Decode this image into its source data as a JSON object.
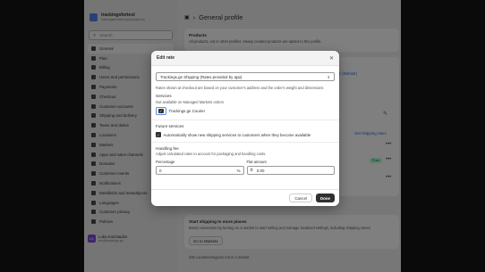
{
  "store": {
    "name": "trackingsfortest",
    "domain": "trackingsfortest.myshopify.com"
  },
  "search": {
    "placeholder": "Search"
  },
  "sidebar": {
    "items": [
      {
        "label": "General",
        "icon": "home-icon",
        "active": true
      },
      {
        "label": "Plan",
        "icon": "plan-icon"
      },
      {
        "label": "Billing",
        "icon": "billing-icon"
      },
      {
        "label": "Users and permissions",
        "icon": "users-icon"
      },
      {
        "label": "Payments",
        "icon": "payments-icon"
      },
      {
        "label": "Checkout",
        "icon": "checkout-icon"
      },
      {
        "label": "Customer accounts",
        "icon": "customer-accounts-icon"
      },
      {
        "label": "Shipping and delivery",
        "icon": "shipping-icon"
      },
      {
        "label": "Taxes and duties",
        "icon": "taxes-icon"
      },
      {
        "label": "Locations",
        "icon": "locations-icon"
      },
      {
        "label": "Markets",
        "icon": "markets-icon"
      },
      {
        "label": "Apps and sales channels",
        "icon": "apps-icon"
      },
      {
        "label": "Domains",
        "icon": "domains-icon"
      },
      {
        "label": "Customer events",
        "icon": "events-icon"
      },
      {
        "label": "Notifications",
        "icon": "notifications-icon"
      },
      {
        "label": "Metafields and metaobjects",
        "icon": "metafields-icon"
      },
      {
        "label": "Languages",
        "icon": "languages-icon"
      },
      {
        "label": "Customer privacy",
        "icon": "privacy-icon"
      },
      {
        "label": "Policies",
        "icon": "policies-icon"
      }
    ]
  },
  "user": {
    "initials": "LK",
    "name": "Luka Kutchaidze",
    "email": "arc@trackings.ge"
  },
  "page": {
    "title": "General profile",
    "products_title": "Products",
    "products_desc": "All products, not in other profiles. Newly created products are added to this profile.",
    "manage_link": "ge (Default)",
    "shipping_link": "Get shipping rates",
    "free_badge": "Free",
    "ship_more_title": "Start shipping to more places",
    "ship_more_desc": "Boost conversion by turning on a market to start selling and manage localized settings, including shipping zones",
    "go_markets": "Go to Markets",
    "countries_note": "235 countries/regions not in a market"
  },
  "modal": {
    "title": "Edit rate",
    "service_select": "Trackings.ge Shipping (Rates provided by app)",
    "rates_helper": "Rates shown at checkout are based on your customer's address and the order's weight and dimensions",
    "services_title": "Services",
    "services_sub": "Not available on Managed Markets orders",
    "courier_label": "Trackings.ge Courier",
    "future_title": "Future services",
    "future_label": "Automatically show new shipping services to customers when they become available",
    "handling_title": "Handling fee",
    "handling_sub": "Adjust calculated rates to account for packaging and handling costs.",
    "percentage_label": "Percentage",
    "percentage_value": "0",
    "percentage_suffix": "%",
    "flat_label": "Flat amount",
    "flat_prefix": "₾",
    "flat_value": "0.00",
    "cancel": "Cancel",
    "done": "Done"
  }
}
